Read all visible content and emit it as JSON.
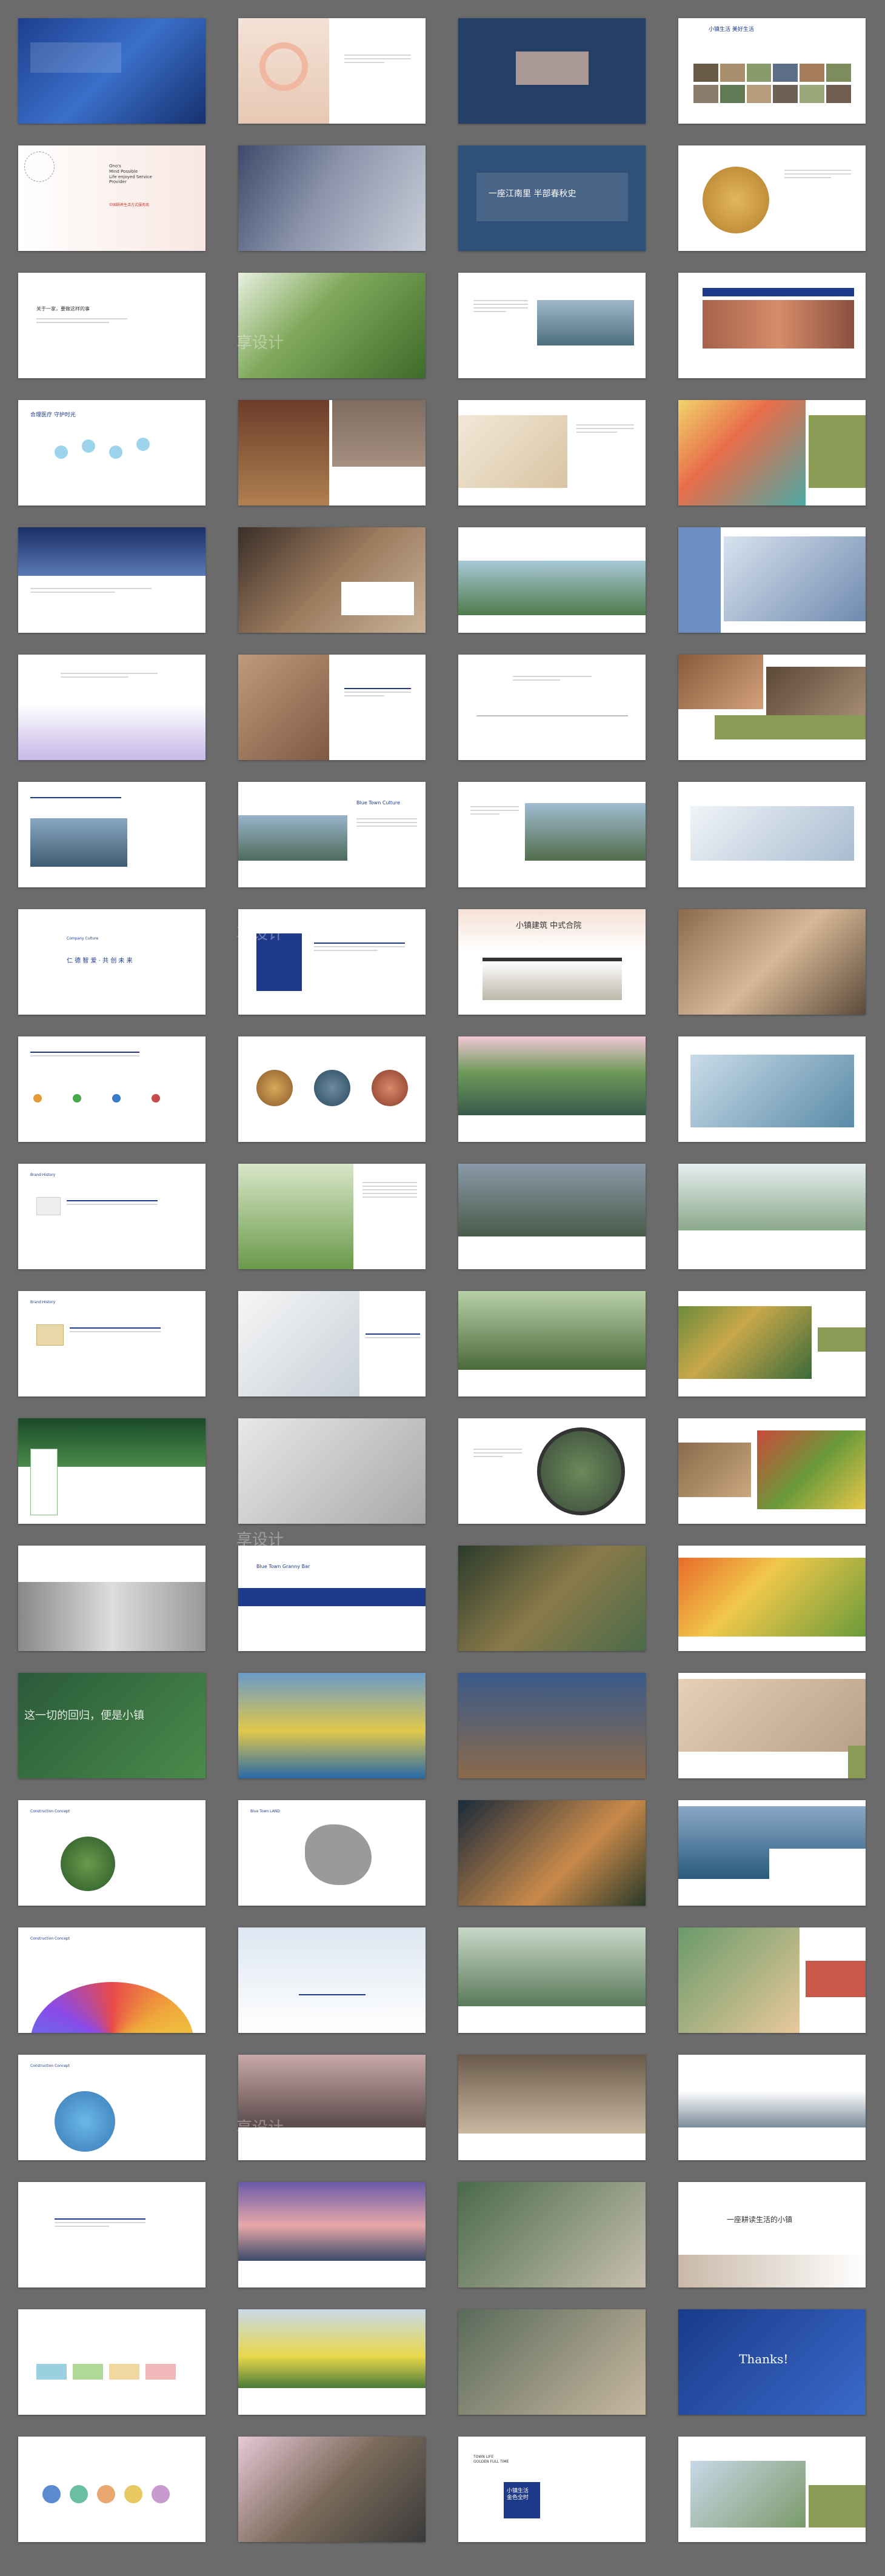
{
  "sheet": {
    "slides": [
      {
        "label": "",
        "sub": ""
      },
      {
        "label": "",
        "sub": ""
      },
      {
        "label": "",
        "sub": ""
      },
      {
        "label": "小镇生活 美好生活",
        "sub": ""
      },
      {
        "label": "Ono's\nMind Possible\nLife enjoyed Service\nProvider",
        "sub": "中国颐养生活方式服务商"
      },
      {
        "label": "",
        "sub": ""
      },
      {
        "label": "一座江南里  半部春秋史",
        "sub": ""
      },
      {
        "label": "",
        "sub": ""
      },
      {
        "label": "关于一家，要做这样的事",
        "sub": ""
      },
      {
        "label": "",
        "sub": ""
      },
      {
        "label": "",
        "sub": ""
      },
      {
        "label": "",
        "sub": ""
      },
      {
        "label": "合理医疗  守护时光",
        "sub": ""
      },
      {
        "label": "",
        "sub": ""
      },
      {
        "label": "",
        "sub": ""
      },
      {
        "label": "",
        "sub": ""
      },
      {
        "label": "",
        "sub": ""
      },
      {
        "label": "",
        "sub": ""
      },
      {
        "label": "",
        "sub": ""
      },
      {
        "label": "",
        "sub": ""
      },
      {
        "label": "",
        "sub": ""
      },
      {
        "label": "",
        "sub": ""
      },
      {
        "label": "",
        "sub": ""
      },
      {
        "label": "",
        "sub": ""
      },
      {
        "label": "",
        "sub": ""
      },
      {
        "label": "Blue Town Culture",
        "sub": ""
      },
      {
        "label": "",
        "sub": ""
      },
      {
        "label": "",
        "sub": ""
      },
      {
        "label": "Company Culture",
        "sub": "仁 德 智 爱 · 共 创 未 来"
      },
      {
        "label": "",
        "sub": ""
      },
      {
        "label": "小镇建筑 中式合院",
        "sub": ""
      },
      {
        "label": "",
        "sub": ""
      },
      {
        "label": "",
        "sub": ""
      },
      {
        "label": "",
        "sub": ""
      },
      {
        "label": "",
        "sub": ""
      },
      {
        "label": "",
        "sub": ""
      },
      {
        "label": "Brand History",
        "sub": ""
      },
      {
        "label": "",
        "sub": ""
      },
      {
        "label": "",
        "sub": ""
      },
      {
        "label": "",
        "sub": ""
      },
      {
        "label": "Brand History",
        "sub": ""
      },
      {
        "label": "",
        "sub": ""
      },
      {
        "label": "",
        "sub": ""
      },
      {
        "label": "",
        "sub": ""
      },
      {
        "label": "",
        "sub": ""
      },
      {
        "label": "",
        "sub": ""
      },
      {
        "label": "",
        "sub": ""
      },
      {
        "label": "",
        "sub": ""
      },
      {
        "label": "",
        "sub": ""
      },
      {
        "label": "Blue Town Granny Bar",
        "sub": ""
      },
      {
        "label": "",
        "sub": ""
      },
      {
        "label": "",
        "sub": ""
      },
      {
        "label": "这一切的回归，便是小镇",
        "sub": ""
      },
      {
        "label": "",
        "sub": ""
      },
      {
        "label": "",
        "sub": ""
      },
      {
        "label": "",
        "sub": ""
      },
      {
        "label": "Construction Concept",
        "sub": ""
      },
      {
        "label": "Blue Town LAND",
        "sub": ""
      },
      {
        "label": "",
        "sub": ""
      },
      {
        "label": "",
        "sub": ""
      },
      {
        "label": "Construction Concept",
        "sub": ""
      },
      {
        "label": "",
        "sub": ""
      },
      {
        "label": "",
        "sub": ""
      },
      {
        "label": "",
        "sub": ""
      },
      {
        "label": "Construction Concept",
        "sub": ""
      },
      {
        "label": "",
        "sub": ""
      },
      {
        "label": "",
        "sub": ""
      },
      {
        "label": "",
        "sub": ""
      },
      {
        "label": "",
        "sub": ""
      },
      {
        "label": "",
        "sub": ""
      },
      {
        "label": "",
        "sub": ""
      },
      {
        "label": "一座耕读生活的小镇",
        "sub": ""
      },
      {
        "label": "",
        "sub": ""
      },
      {
        "label": "",
        "sub": ""
      },
      {
        "label": "",
        "sub": ""
      },
      {
        "label": "Thanks!",
        "sub": ""
      },
      {
        "label": "",
        "sub": ""
      },
      {
        "label": "",
        "sub": ""
      },
      {
        "label": "TOWN LIFE\nGOLDEN FULL TIME",
        "sub": "小镇生活\n金色全时"
      },
      {
        "label": "",
        "sub": ""
      }
    ]
  },
  "watermark": {
    "text": "享设计"
  },
  "colors": {
    "background": "#6b6b6b",
    "brand_blue": "#1e3a8a",
    "accent_red": "#c0392b",
    "olive": "#7b8a4b"
  }
}
